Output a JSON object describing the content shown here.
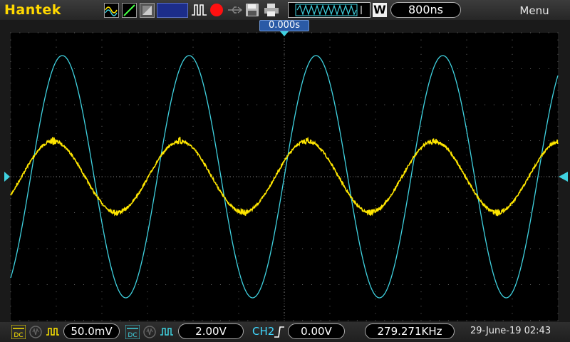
{
  "header": {
    "brand": "Hantek",
    "timebase": "800ns",
    "waveform_button": "W",
    "menu": "Menu"
  },
  "screen": {
    "trigger_position": "0.000s"
  },
  "footer": {
    "ch1_coupling": "DC",
    "ch1_scale": "50.0mV",
    "ch2_coupling": "DC",
    "ch2_scale": "2.00V",
    "trigger_source": "CH2",
    "trigger_level": "0.00V",
    "frequency": "279.271KHz",
    "datetime": "29-June-19 02:43"
  },
  "colors": {
    "ch1": "#ffe600",
    "ch2": "#3fd2e0",
    "brand": "#ffd800",
    "record": "#ff1010"
  },
  "icons": [
    "ch1-coupling-icon",
    "ch1-bandwidth-icon",
    "ch2-coupling-icon",
    "trigger-edge-icon",
    "save-icon",
    "print-icon",
    "run-stop-icon"
  ]
}
